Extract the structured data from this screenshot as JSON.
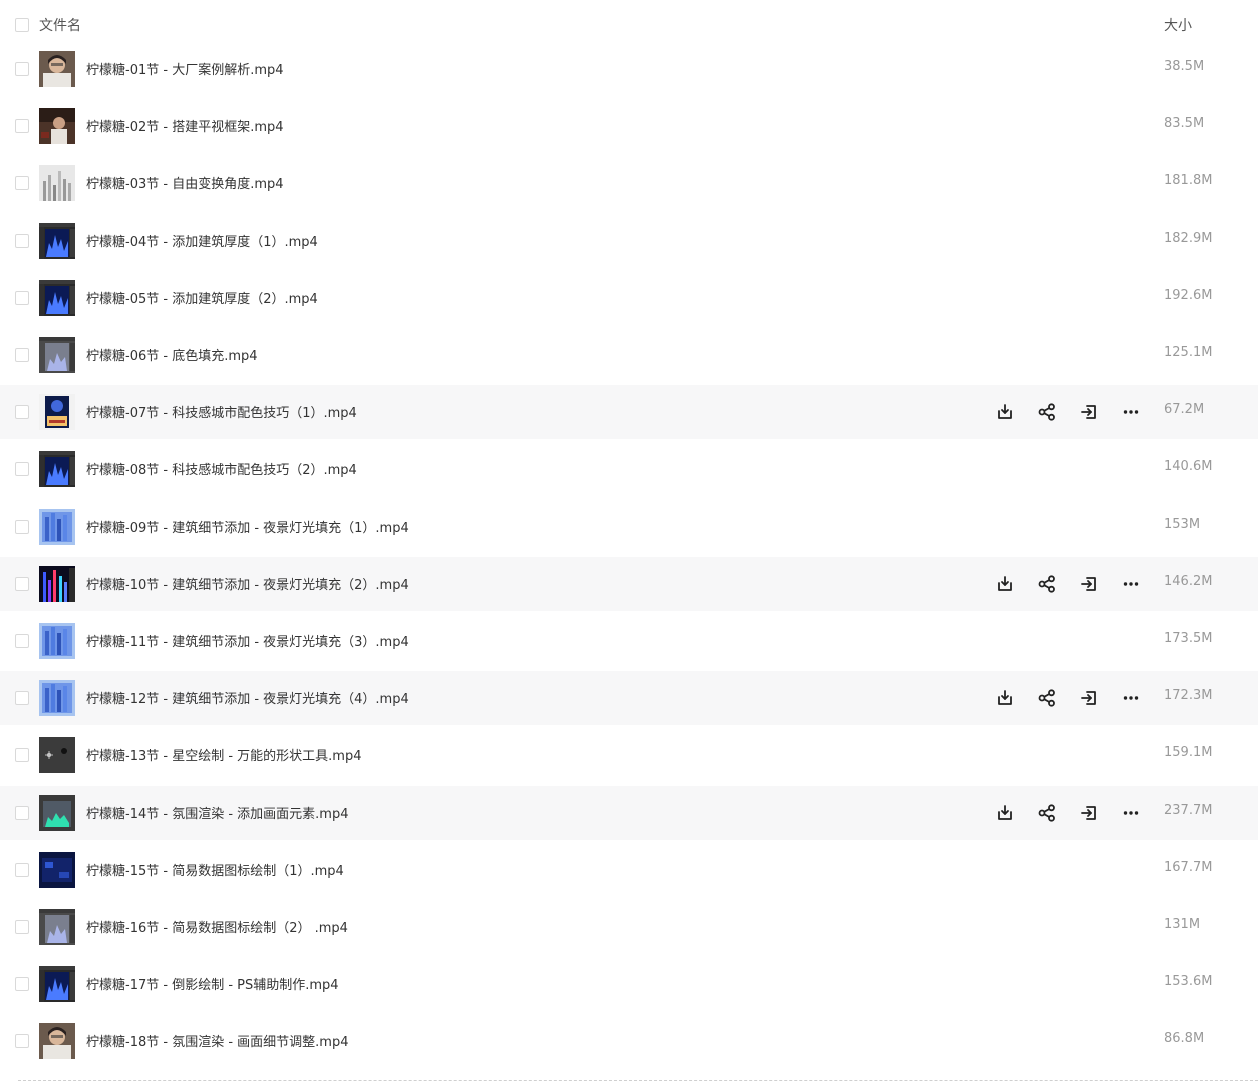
{
  "header": {
    "name_label": "文件名",
    "size_label": "大小"
  },
  "files": [
    {
      "name": "柠檬糖-01节 - 大厂案例解析.mp4",
      "size": "38.5M",
      "thumb": "portrait"
    },
    {
      "name": "柠檬糖-02节 - 搭建平视框架.mp4",
      "size": "83.5M",
      "thumb": "portrait-dark"
    },
    {
      "name": "柠檬糖-03节 - 自由变换角度.mp4",
      "size": "181.8M",
      "thumb": "bars-gray"
    },
    {
      "name": "柠檬糖-04节 - 添加建筑厚度（1）.mp4",
      "size": "182.9M",
      "thumb": "screen-blue"
    },
    {
      "name": "柠檬糖-05节 - 添加建筑厚度（2）.mp4",
      "size": "192.6M",
      "thumb": "screen-blue"
    },
    {
      "name": "柠檬糖-06节 - 底色填充.mp4",
      "size": "125.1M",
      "thumb": "screen-gray"
    },
    {
      "name": "柠檬糖-07节 - 科技感城市配色技巧（1）.mp4",
      "size": "67.2M",
      "thumb": "poster"
    },
    {
      "name": "柠檬糖-08节 - 科技感城市配色技巧（2）.mp4",
      "size": "140.6M",
      "thumb": "screen-blue"
    },
    {
      "name": "柠檬糖-09节 - 建筑细节添加 - 夜景灯光填充（1）.mp4",
      "size": "153M",
      "thumb": "screen-lightblue"
    },
    {
      "name": "柠檬糖-10节 - 建筑细节添加 - 夜景灯光填充（2）.mp4",
      "size": "146.2M",
      "thumb": "screen-neon"
    },
    {
      "name": "柠檬糖-11节 - 建筑细节添加 - 夜景灯光填充（3）.mp4",
      "size": "173.5M",
      "thumb": "screen-lightblue"
    },
    {
      "name": "柠檬糖-12节 - 建筑细节添加 - 夜景灯光填充（4）.mp4",
      "size": "172.3M",
      "thumb": "screen-lightblue"
    },
    {
      "name": "柠檬糖-13节 - 星空绘制 - 万能的形状工具.mp4",
      "size": "159.1M",
      "thumb": "dark-dots"
    },
    {
      "name": "柠檬糖-14节 - 氛围渲染 - 添加画面元素.mp4",
      "size": "237.7M",
      "thumb": "screen-teal"
    },
    {
      "name": "柠檬糖-15节 - 简易数据图标绘制（1）.mp4",
      "size": "167.7M",
      "thumb": "screen-navy"
    },
    {
      "name": "柠檬糖-16节 - 简易数据图标绘制（2） .mp4",
      "size": "131M",
      "thumb": "screen-gray"
    },
    {
      "name": "柠檬糖-17节 - 倒影绘制 - PS辅助制作.mp4",
      "size": "153.6M",
      "thumb": "screen-blue"
    },
    {
      "name": "柠檬糖-18节 - 氛围渲染 - 画面细节调整.mp4",
      "size": "86.8M",
      "thumb": "portrait"
    }
  ],
  "highlighted_rows": [
    6,
    9,
    11,
    13
  ],
  "icons": {
    "download": "download-icon",
    "share": "share-icon",
    "move": "move-to-icon",
    "more": "more-icon"
  }
}
